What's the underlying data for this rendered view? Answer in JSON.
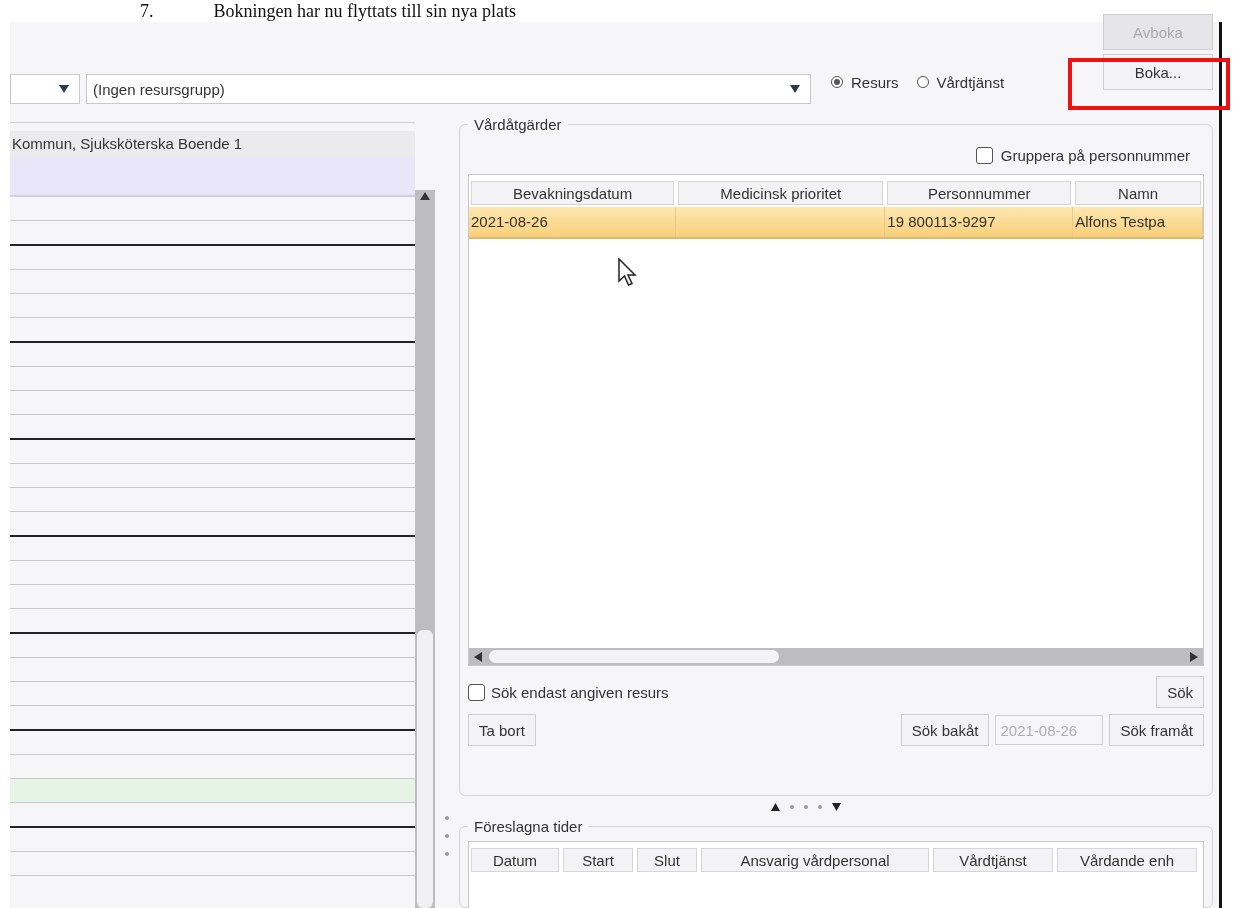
{
  "document_heading": {
    "number": "7.",
    "text": "Bokningen har nu flyttats till sin nya plats"
  },
  "toolbar": {
    "combos": [
      {
        "kind": "narrow"
      },
      {
        "value": "(Ingen resursgrupp)"
      }
    ],
    "radios": [
      {
        "label": "Resurs",
        "selected": true
      },
      {
        "label": "Vårdtjänst",
        "selected": false
      }
    ],
    "buttons": [
      {
        "label": "Avboka",
        "disabled": true,
        "highlighted": false
      },
      {
        "label": "Boka...",
        "disabled": false,
        "highlighted": true
      }
    ]
  },
  "schedule": {
    "header": "Kommun, Sjuksköterska Boende 1",
    "slots": [
      {
        "kind": "empty"
      },
      {
        "kind": "empty"
      },
      {
        "kind": "empty"
      },
      {
        "kind": "empty"
      },
      {
        "kind": "empty"
      },
      {
        "kind": "empty"
      },
      {
        "kind": "empty"
      },
      {
        "kind": "empty"
      },
      {
        "kind": "empty"
      },
      {
        "kind": "empty"
      },
      {
        "kind": "empty"
      },
      {
        "kind": "empty"
      },
      {
        "kind": "empty"
      },
      {
        "kind": "empty"
      },
      {
        "kind": "empty"
      },
      {
        "kind": "empty"
      },
      {
        "kind": "empty"
      },
      {
        "kind": "empty"
      },
      {
        "kind": "empty"
      },
      {
        "kind": "empty"
      },
      {
        "kind": "empty"
      },
      {
        "kind": "empty"
      },
      {
        "kind": "empty"
      },
      {
        "kind": "empty"
      },
      {
        "kind": "marked"
      },
      {
        "kind": "empty"
      },
      {
        "kind": "empty"
      },
      {
        "kind": "empty"
      }
    ]
  },
  "vardatgarder": {
    "title": "Vårdåtgärder",
    "group_checkbox": {
      "label": "Gruppera på personnummer",
      "checked": false
    },
    "columns": [
      "Bevakningsdatum",
      "Medicinsk prioritet",
      "Personnummer",
      "Namn"
    ],
    "rows": [
      {
        "cells": [
          "2021-08-26",
          null,
          "19 800113-9297",
          "Alfons Testpa"
        ],
        "selected": true
      }
    ],
    "resource_checkbox": {
      "label": "Sök endast angiven resurs",
      "checked": false
    },
    "search_button": "Sök",
    "remove_button": "Ta bort",
    "back_button": "Sök bakåt",
    "date_field": {
      "value": "2021-08-26",
      "disabled": true
    },
    "forward_button": "Sök framåt"
  },
  "foreslagna_tider": {
    "title": "Föreslagna tider",
    "columns": [
      "Datum",
      "Start",
      "Slut",
      "Ansvarig vårdpersonal",
      "Vårdtjänst",
      "Vårdande enh"
    ]
  }
}
